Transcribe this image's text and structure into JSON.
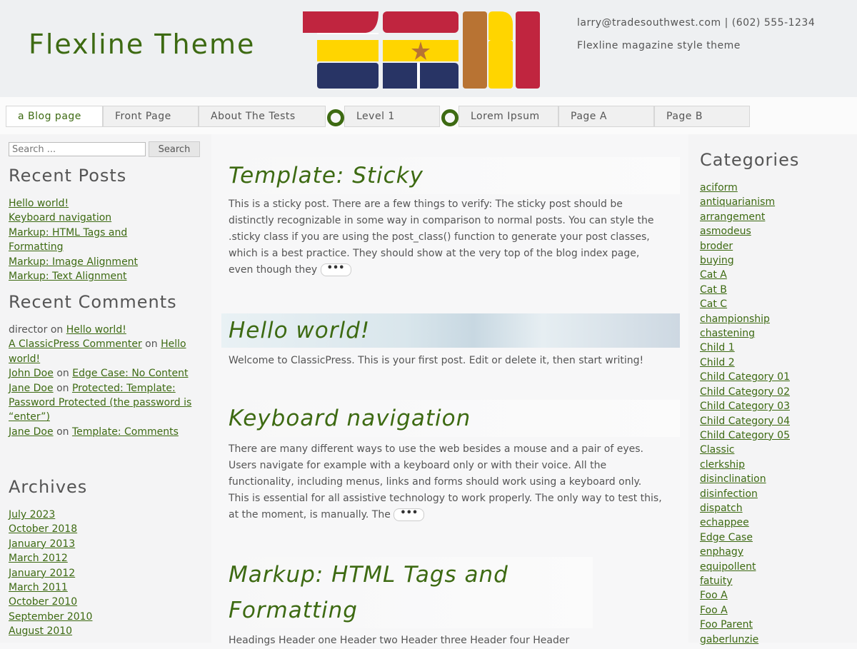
{
  "site": {
    "title": "Flexline Theme",
    "contact": "larry@tradesouthwest.com | (602) 555-1234",
    "tagline": "Flexline magazine style theme"
  },
  "colors": {
    "accent": "#3d6a12",
    "logo_red": "#c0253f",
    "logo_yellow": "#ffd500",
    "logo_navy": "#283465",
    "logo_brown": "#b87333"
  },
  "nav": {
    "items": [
      "a Blog page",
      "Front Page",
      "About The Tests",
      "Level 1",
      "Lorem Ipsum",
      "Page A",
      "Page B"
    ]
  },
  "search": {
    "placeholder": "Search ...",
    "button_label": "Search"
  },
  "recent_posts": {
    "title": "Recent Posts",
    "items": [
      "Hello world!",
      "Keyboard navigation",
      "Markup: HTML Tags and",
      "Formatting",
      "Markup: Image Alignment",
      "Markup: Text Alignment"
    ]
  },
  "recent_comments": {
    "title": "Recent Comments",
    "c1_author": "director",
    "on": "on",
    "c1_post": "Hello world!",
    "c2_author": "A ClassicPress Commenter",
    "c2_post": "Hello world!",
    "c3_author": "John Doe",
    "c3_post": "Edge Case: No Content",
    "c4_author": "Jane Doe",
    "c4_post": "Protected: Template: Password Protected (the password is “enter”)",
    "c5_author": "Jane Doe",
    "c5_post": "Template: Comments"
  },
  "archives": {
    "title": "Archives",
    "items": [
      "July 2023",
      "October 2018",
      "January 2013",
      "March 2012",
      "January 2012",
      "March 2011",
      "October 2010",
      "September 2010",
      "August 2010"
    ]
  },
  "posts": [
    {
      "title": "Template: Sticky",
      "excerpt": "This is a sticky post. There are a few things to verify: The sticky post should be distinctly recognizable in some way in comparison to normal posts. You can style the .sticky class if you are using the post_class() function to generate your post classes, which is a best practice. They should show at the very top of the blog index page, even though they",
      "more": "•••"
    },
    {
      "title": "Hello world!",
      "excerpt": "Welcome to ClassicPress. This is your first post. Edit or delete it, then start writing!"
    },
    {
      "title": "Keyboard navigation",
      "excerpt": "There are many different ways to use the web besides a mouse and a pair of eyes. Users navigate for example with a keyboard only or with their voice. All the functionality, including menus, links and forms should work using a keyboard only. This is essential for all assistive technology to work properly. The only way to test this, at the moment, is manually. The",
      "more": "•••"
    },
    {
      "title": "Markup: HTML Tags and Formatting",
      "excerpt": "Headings Header one Header two Header three Header four Header"
    }
  ],
  "categories": {
    "title": "Categories",
    "items": [
      "aciform",
      "antiquarianism",
      "arrangement",
      "asmodeus",
      "broder",
      "buying",
      "Cat A",
      "Cat B",
      "Cat C",
      "championship",
      "chastening",
      "Child 1",
      "Child 2",
      "Child Category 01",
      "Child Category 02",
      "Child Category 03",
      "Child Category 04",
      "Child Category 05",
      "Classic",
      "clerkship",
      "disinclination",
      "disinfection",
      "dispatch",
      "echappee",
      "Edge Case",
      "enphagy",
      "equipollent",
      "fatuity",
      "Foo A",
      "Foo A",
      "Foo Parent",
      "gaberlunzie"
    ]
  }
}
